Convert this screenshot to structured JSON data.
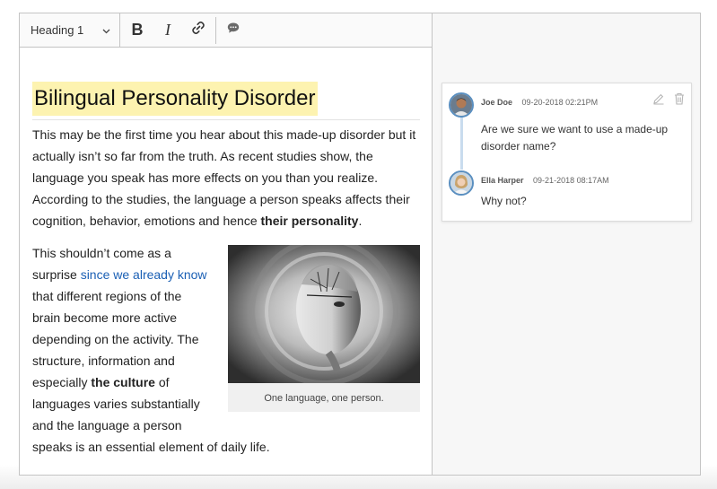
{
  "toolbar": {
    "heading_label": "Heading 1",
    "bold_label": "B",
    "italic_label": "I"
  },
  "document": {
    "title": "Bilingual Personality Disorder",
    "paragraph1": {
      "text": "This may be the first time you hear about this made-up disorder but it actually isn’t so far from the truth. As recent studies show, the language you speak has more effects on you than you realize. According to the studies, the language a person speaks affects their cognition, behavior, emotions and hence ",
      "bold": "their personality",
      "end": "."
    },
    "paragraph2": {
      "before_link": "This shouldn’t come as a surprise ",
      "link": "since we already know",
      "after_link": " that different regions of the brain become more active depending on the activity. The structure, information and especially ",
      "bold": "the culture",
      "end": " of languages varies substantially and the language a person speaks is an essential element of daily life."
    },
    "figure_caption": "One language, one person."
  },
  "comments": [
    {
      "author": "Joe Doe",
      "timestamp": "09-20-2018 02:21PM",
      "text": "Are we sure we want to use a made-up disorder name?"
    },
    {
      "author": "Ella Harper",
      "timestamp": "09-21-2018 08:17AM",
      "text": "Why not?"
    }
  ],
  "icons": {
    "heading_dropdown": "chevron-down-icon",
    "link": "link-icon",
    "comment": "comment-icon",
    "edit": "pencil-icon",
    "delete": "trash-icon"
  },
  "colors": {
    "highlight": "#fdf3b0",
    "link": "#1a5fb4",
    "thread_line": "#c9dcee",
    "avatar_border": "#5a8fc0"
  }
}
